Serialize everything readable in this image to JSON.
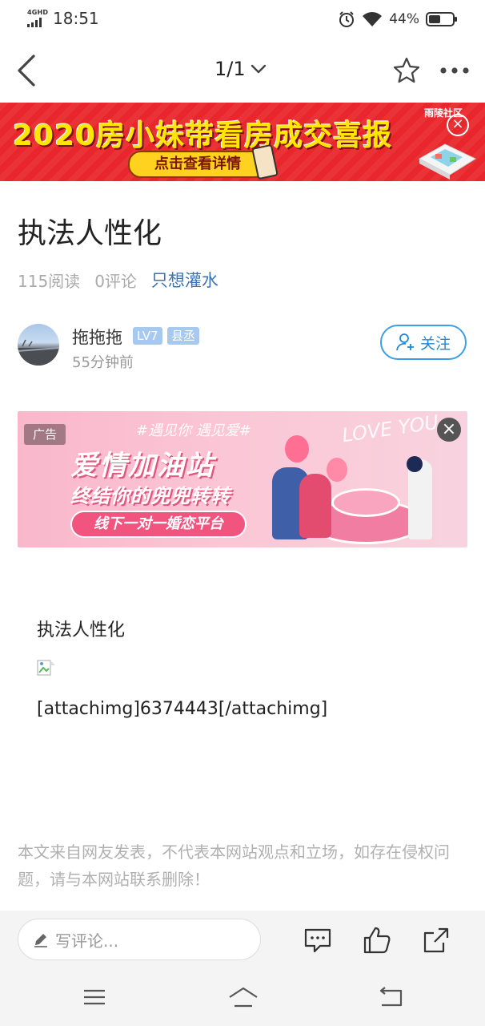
{
  "status_bar": {
    "network": "4GHD",
    "time": "18:51",
    "battery": "44%"
  },
  "nav": {
    "page_indicator": "1/1"
  },
  "banner": {
    "title": "2020房小妹带看房成交喜报",
    "button": "点击查看详情",
    "brand": "雨陵社区"
  },
  "article": {
    "title": "执法人性化",
    "reads": "115阅读",
    "comments": "0评论",
    "tag": "只想灌水"
  },
  "author": {
    "name": "拖拖拖",
    "level": "LV7",
    "rank": "县丞",
    "time": "55分钟前",
    "follow_label": "关注"
  },
  "ad": {
    "label": "广告",
    "top_text": "#遇见你 遇见爱#",
    "main_text": "爱情加油站",
    "sub_text": "终结你的兜兜转转",
    "pill_text": "线下一对一婚恋平台",
    "love_text": "LOVE YOU"
  },
  "content": {
    "text": "执法人性化",
    "attach": "[attachimg]6374443[/attachimg]"
  },
  "disclaimer": "本文来自网友发表，不代表本网站观点和立场，如存在侵权问题，请与本网站联系删除！",
  "bottom": {
    "comment_placeholder": "写评论..."
  },
  "colors": {
    "banner_red": "#e8262b",
    "follow_blue": "#1e88d6",
    "tag_blue": "#3a73b8"
  }
}
